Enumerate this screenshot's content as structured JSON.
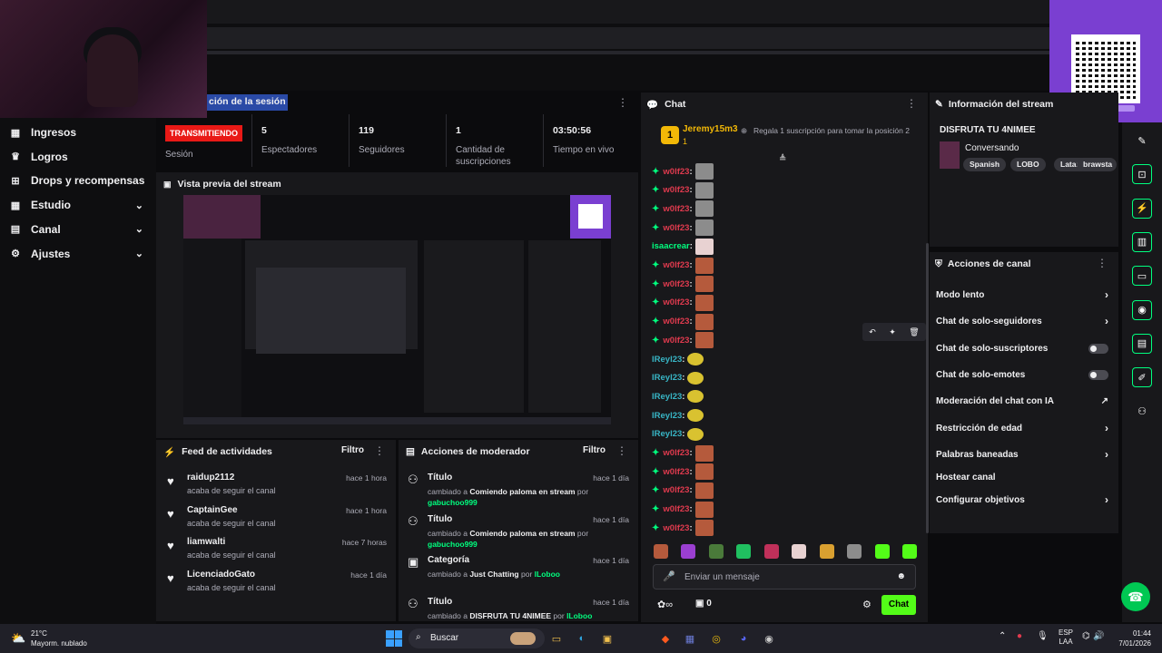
{
  "session_title": "ción de la sesión",
  "sidebar": {
    "items": [
      {
        "label": "Ingresos",
        "icon": "money-icon",
        "has_chevron": false
      },
      {
        "label": "Logros",
        "icon": "trophy-icon",
        "has_chevron": false
      },
      {
        "label": "Drops y recompensas",
        "icon": "gift-icon",
        "has_chevron": false
      },
      {
        "label": "Estudio",
        "icon": "grid-icon",
        "has_chevron": true
      },
      {
        "label": "Canal",
        "icon": "list-icon",
        "has_chevron": true
      },
      {
        "label": "Ajustes",
        "icon": "gear-icon",
        "has_chevron": true
      }
    ]
  },
  "stats": [
    {
      "value": "TRANSMITIENDO",
      "label": "Sesión"
    },
    {
      "value": "5",
      "label": "Espectadores"
    },
    {
      "value": "119",
      "label": "Seguidores"
    },
    {
      "value": "1",
      "label": "Cantidad de suscripciones"
    },
    {
      "value": "03:50:56",
      "label": "Tiempo en vivo"
    }
  ],
  "preview": {
    "title": "Vista previa del stream"
  },
  "feed": {
    "title": "Feed de actividades",
    "filter": "Filtro",
    "items": [
      {
        "name": "raidup2112",
        "sub": "acaba de seguir el canal",
        "time": "hace 1 hora"
      },
      {
        "name": "CaptainGee",
        "sub": "acaba de seguir el canal",
        "time": "hace 1 hora"
      },
      {
        "name": "liamwalti",
        "sub": "acaba de seguir el canal",
        "time": "hace 7 horas"
      },
      {
        "name": "LicenciadoGato",
        "sub": "acaba de seguir el canal",
        "time": "hace 1 día"
      }
    ]
  },
  "mod": {
    "title": "Acciones de moderador",
    "filter": "Filtro",
    "items": [
      {
        "name": "Título",
        "pre": "cambiado a ",
        "value": "Comiendo paloma en stream",
        "by": " por ",
        "user": "gabuchoo999",
        "time": "hace 1 día"
      },
      {
        "name": "Título",
        "pre": "cambiado a ",
        "value": "Comiendo paloma en stream",
        "by": " por ",
        "user": "gabuchoo999",
        "time": "hace 1 día"
      },
      {
        "name": "Categoría",
        "pre": "cambiado a ",
        "value": "Just Chatting",
        "by": " por ",
        "user": "lLoboo",
        "time": "hace 1 día"
      },
      {
        "name": "Título",
        "pre": "cambiado a ",
        "value": "DISFRUTA TU 4NIMEE",
        "by": " por ",
        "user": "lLoboo",
        "time": "hace 1 día"
      }
    ]
  },
  "chat": {
    "title": "Chat",
    "pinned_user": "Jeremy15m3",
    "pinned_count": "1",
    "pinned_rank": "1",
    "gift_text": "Regala 1 suscripción para tomar la posición 2",
    "messages": [
      {
        "user": "w0lf23",
        "color": "#e03a4e",
        "badge": true,
        "emote": "grey"
      },
      {
        "user": "w0lf23",
        "color": "#e03a4e",
        "badge": true,
        "emote": "grey"
      },
      {
        "user": "w0lf23",
        "color": "#e03a4e",
        "badge": true,
        "emote": "grey"
      },
      {
        "user": "w0lf23",
        "color": "#e03a4e",
        "badge": true,
        "emote": "grey"
      },
      {
        "user": "isaacrear",
        "color": "#00ff7f",
        "badge": false,
        "emote": "pink"
      },
      {
        "user": "w0lf23",
        "color": "#e03a4e",
        "badge": true,
        "emote": "red"
      },
      {
        "user": "w0lf23",
        "color": "#e03a4e",
        "badge": true,
        "emote": "red"
      },
      {
        "user": "w0lf23",
        "color": "#e03a4e",
        "badge": true,
        "emote": "red"
      },
      {
        "user": "w0lf23",
        "color": "#e03a4e",
        "badge": true,
        "emote": "red"
      },
      {
        "user": "w0lf23",
        "color": "#e03a4e",
        "badge": true,
        "emote": "red"
      },
      {
        "user": "lReyl23",
        "color": "#38b6c6",
        "badge": false,
        "emote": "yel"
      },
      {
        "user": "lReyl23",
        "color": "#38b6c6",
        "badge": false,
        "emote": "yel"
      },
      {
        "user": "lReyl23",
        "color": "#38b6c6",
        "badge": false,
        "emote": "yel"
      },
      {
        "user": "lReyl23",
        "color": "#38b6c6",
        "badge": false,
        "emote": "yel"
      },
      {
        "user": "lReyl23",
        "color": "#38b6c6",
        "badge": false,
        "emote": "yel"
      },
      {
        "user": "w0lf23",
        "color": "#e03a4e",
        "badge": true,
        "emote": "red"
      },
      {
        "user": "w0lf23",
        "color": "#e03a4e",
        "badge": true,
        "emote": "red"
      },
      {
        "user": "w0lf23",
        "color": "#e03a4e",
        "badge": true,
        "emote": "red"
      },
      {
        "user": "w0lf23",
        "color": "#e03a4e",
        "badge": true,
        "emote": "red"
      },
      {
        "user": "w0lf23",
        "color": "#e03a4e",
        "badge": true,
        "emote": "red"
      }
    ],
    "input_placeholder": "Enviar un mensaje",
    "points": "0",
    "send_label": "Chat"
  },
  "info": {
    "title": "Información del stream",
    "stream_title": "DISFRUTA TU 4NIMEE",
    "category": "Conversando",
    "tags": [
      "Spanish",
      "LOBO",
      "Latam",
      "brawsta"
    ]
  },
  "actions": {
    "title": "Acciones de canal",
    "items": [
      {
        "label": "Modo lento",
        "control": "chevron"
      },
      {
        "label": "Chat de solo-seguidores",
        "control": "chevron"
      },
      {
        "label": "Chat de solo-suscriptores",
        "control": "toggle"
      },
      {
        "label": "Chat de solo-emotes",
        "control": "toggle"
      },
      {
        "label": "Moderación del chat con IA",
        "control": "external"
      },
      {
        "label": "Restricción de edad",
        "control": "chevron"
      },
      {
        "label": "Palabras baneadas",
        "control": "chevron"
      },
      {
        "label": "Hostear canal",
        "control": "none"
      },
      {
        "label": "Configurar objetivos",
        "control": "chevron"
      }
    ]
  },
  "taskbar": {
    "weather_temp": "21°C",
    "weather_desc": "Mayorm. nublado",
    "search": "Buscar",
    "lang1": "ESP",
    "lang2": "LAA",
    "time": "01:44",
    "date": "7/01/2026"
  },
  "colors": {
    "accent": "#53fc18",
    "live": "#e91916",
    "panel": "#18181b"
  }
}
